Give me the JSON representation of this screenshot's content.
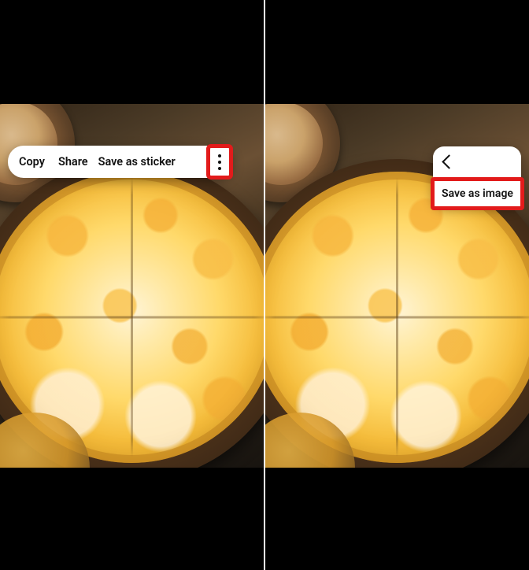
{
  "panel1": {
    "toolbar": {
      "copy": "Copy",
      "share": "Share",
      "save_as_sticker": "Save as sticker"
    },
    "more_icon": "more-vertical"
  },
  "panel2": {
    "popover": {
      "back_icon": "chevron-left",
      "save_as_image": "Save as image"
    }
  },
  "highlight_color": "#e21b1b"
}
